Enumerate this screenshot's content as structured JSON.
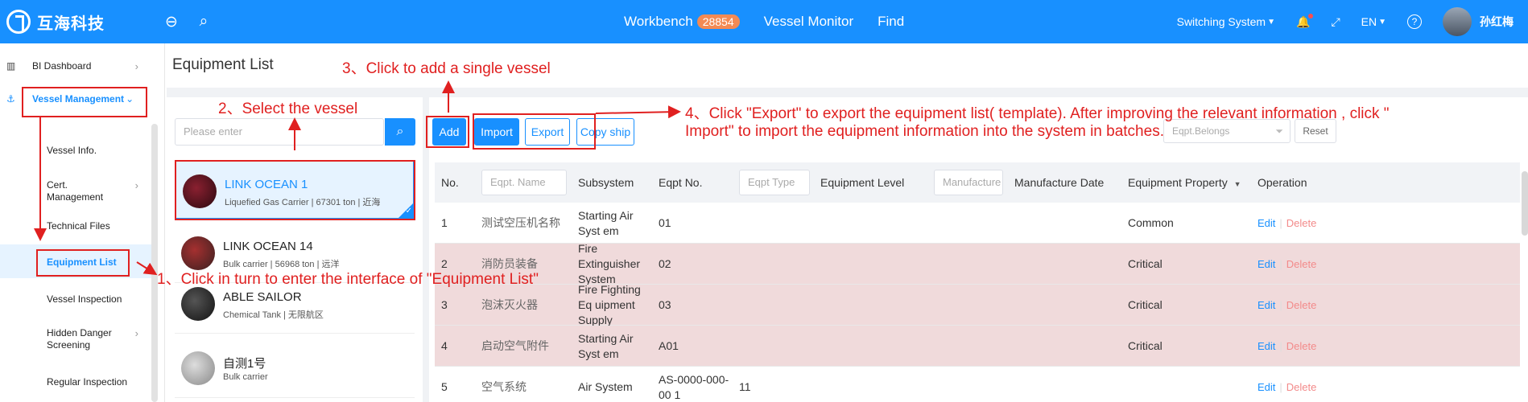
{
  "header": {
    "logo_text": "互海科技",
    "nav": [
      {
        "label": "Workbench",
        "badge": "28854"
      },
      {
        "label": "Vessel Monitor"
      },
      {
        "label": "Find"
      }
    ],
    "switching_system": "Switching System",
    "language": "EN",
    "user_name": "孙红梅"
  },
  "sidebar": {
    "bi_dashboard": "BI Dashboard",
    "vessel_management": "Vessel Management",
    "items": [
      "Vessel Info.",
      "Cert. Management",
      "Technical Files",
      "Equipment List",
      "Vessel Inspection",
      "Hidden Danger Screening",
      "Regular Inspection"
    ]
  },
  "page": {
    "title": "Equipment List",
    "search_placeholder": "Please enter"
  },
  "vessels": [
    {
      "name": "LINK OCEAN 1",
      "sub": "Liquefied Gas Carrier | 67301 ton | 近海"
    },
    {
      "name": "LINK OCEAN 14",
      "sub": "Bulk carrier | 56968 ton | 远洋"
    },
    {
      "name": "ABLE SAILOR",
      "sub": "Chemical Tank | 无限航区"
    },
    {
      "name": "自测1号",
      "sub": "Bulk carrier"
    }
  ],
  "toolbar": {
    "add": "Add",
    "import": "Import",
    "export": "Export",
    "copy_ship": "Copy ship",
    "eqpt_belongs_placeholder": "Eqpt.Belongs",
    "reset": "Reset"
  },
  "table": {
    "headers": {
      "no": "No.",
      "eqpt_name": "Eqpt. Name",
      "subsystem": "Subsystem",
      "eqpt_no": "Eqpt No.",
      "eqpt_type": "Eqpt Type",
      "equipment_level": "Equipment Level",
      "manufacture": "Manufacture",
      "manufacture_date": "Manufacture Date",
      "equipment_property": "Equipment Property",
      "operation": "Operation"
    },
    "edit": "Edit",
    "delete": "Delete",
    "rows": [
      {
        "no": "1",
        "name": "测试空压机名称",
        "subsystem": "Starting Air Syst em",
        "eqpt_no": "01",
        "type": "",
        "property": "Common",
        "critical": false
      },
      {
        "no": "2",
        "name": "消防员装备",
        "subsystem": "Fire Extinguisher System",
        "eqpt_no": "02",
        "type": "",
        "property": "Critical",
        "critical": true
      },
      {
        "no": "3",
        "name": "泡沫灭火器",
        "subsystem": "Fire Fighting Eq uipment Supply",
        "eqpt_no": "03",
        "type": "",
        "property": "Critical",
        "critical": true
      },
      {
        "no": "4",
        "name": "启动空气附件",
        "subsystem": "Starting Air Syst em",
        "eqpt_no": "A01",
        "type": "",
        "property": "Critical",
        "critical": true
      },
      {
        "no": "5",
        "name": "空气系统",
        "subsystem": "Air System",
        "eqpt_no": "AS-0000-000-00 1",
        "type": "11",
        "property": "",
        "critical": false
      }
    ]
  },
  "annotations": {
    "step1": "1、Click in turn to enter the interface of \"Equipment List\"",
    "step2": "2、Select the vessel",
    "step3": "3、Click to add a single vessel",
    "step4_line1": "4、Click \"Export\" to export the equipment list( template). After improving the relevant information , click \"",
    "step4_line2": "Import\" to import the equipment information into the system in batches."
  },
  "colors": {
    "primary": "#1890ff",
    "critical_row": "#f0dadb",
    "annotation": "#e02020"
  }
}
